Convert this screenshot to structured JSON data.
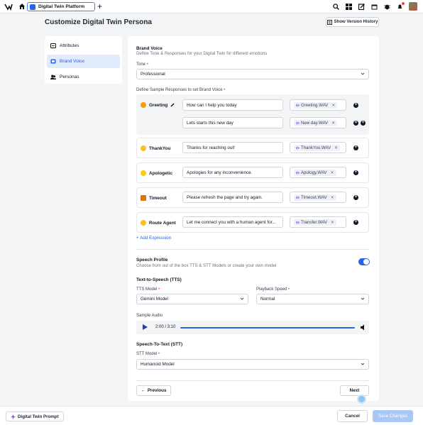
{
  "topbar": {
    "tab_title": "Digital Twin Platform"
  },
  "page": {
    "title": "Customize Digital Twin Persona",
    "version_history": "Show Version History"
  },
  "nav": {
    "items": [
      {
        "label": "Attributes",
        "icon": "document-icon"
      },
      {
        "label": "Brand Voice",
        "icon": "chat-icon"
      },
      {
        "label": "Personas",
        "icon": "people-icon"
      }
    ],
    "active": "Brand Voice"
  },
  "brand_voice": {
    "title": "Brand Voice",
    "subtitle": "Define Tone & Responses for your Digital Twin for different emotions",
    "tone_label": "Tone",
    "tone_value": "Professional",
    "responses_label": "Define Sample Responses to set Brand Voice",
    "rows": [
      {
        "emotion": "Greeting",
        "response": "How can I help you today",
        "audio": "Greeting.WAV"
      },
      {
        "emotion": "",
        "response": "Lets starts this new day",
        "audio": "New day.WAV"
      },
      {
        "emotion": "ThankYou",
        "response": "Thanks for reaching out!",
        "audio": "ThankYou.WAV"
      },
      {
        "emotion": "Apologetic",
        "response": "Apologies for any inconvenience.",
        "audio": "Apology.WAV"
      },
      {
        "emotion": "Timeout",
        "response": "Please refresh the page and try again.",
        "audio": "Timeout.WAV"
      },
      {
        "emotion": "Route Agent",
        "response": "Let me connect you with a human agent for...",
        "audio": "Transfer.WAV"
      }
    ],
    "add_expression": "+ Add Expression"
  },
  "speech": {
    "title": "Speech Profile",
    "subtitle": "Choose from out of the box TTS & STT Models or create your own model",
    "toggle_on": true,
    "tts_title": "Text-to-Speech (TTS)",
    "tts_model_label": "TTS Model",
    "tts_model_value": "Gemini Model",
    "playback_label": "Playback Speed",
    "playback_value": "Normal",
    "sample_audio_label": "Sample Audio",
    "player_time": "2:00 / 3:10",
    "player_progress": 1.0,
    "stt_title": "Speech-To-Text (STT)",
    "stt_model_label": "STT Model",
    "stt_model_value": "Humanoid Model"
  },
  "nav_buttons": {
    "previous": "Previous",
    "next": "Next"
  },
  "footer": {
    "prompt": "Digital Twin Prompt",
    "cancel": "Cancel",
    "save": "Save Changes"
  },
  "colors": {
    "accent": "#2563eb",
    "active_bg": "#e0ebfb",
    "save_disabled": "#a9c7f5"
  }
}
